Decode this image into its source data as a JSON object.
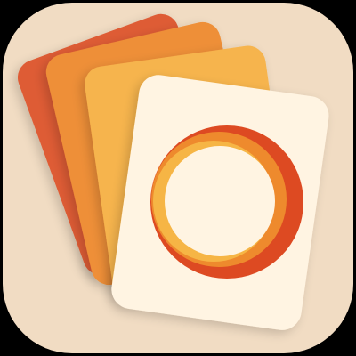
{
  "icon": {
    "name": "stacked-photo-cards-app-icon",
    "glyph": "camera-lens-ring-icon"
  },
  "colors": {
    "frame": "#000000",
    "tile_background": "#F1DCC3",
    "card_back": "#DE5B34",
    "card_second": "#EE8F37",
    "card_third": "#F6B44E",
    "card_front": "#FFF4E2",
    "ring_outer_red": "#DD4A22",
    "ring_orange": "#EE8A2D",
    "ring_yellow": "#F6B545"
  }
}
